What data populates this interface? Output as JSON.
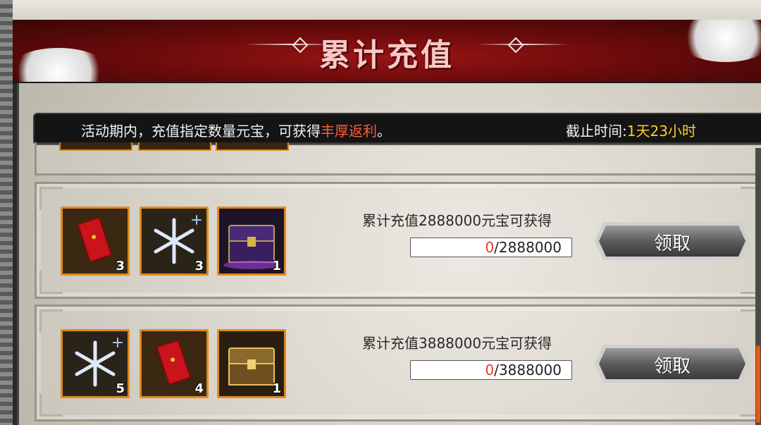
{
  "banner": {
    "title": "累计充值"
  },
  "info": {
    "text_prefix": "活动期内，充值指定数量元宝，可获得",
    "text_highlight": "丰厚返利",
    "text_suffix": "。",
    "deadline_label": "截止时间:",
    "deadline_value": "1天23小时"
  },
  "rewards": [
    {
      "description": "累计充值2888000元宝可获得",
      "current": "0",
      "target": "2888000",
      "claim_label": "领取",
      "items": [
        {
          "icon": "red-envelope-icon",
          "count": "3"
        },
        {
          "icon": "snowflake-icon",
          "count": "3"
        },
        {
          "icon": "purple-chest-icon",
          "count": "1"
        }
      ]
    },
    {
      "description": "累计充值3888000元宝可获得",
      "current": "0",
      "target": "3888000",
      "claim_label": "领取",
      "items": [
        {
          "icon": "snowflake-icon",
          "count": "5"
        },
        {
          "icon": "red-envelope-icon",
          "count": "4"
        },
        {
          "icon": "golden-chest-icon",
          "count": "1"
        }
      ]
    }
  ],
  "colors": {
    "highlight": "#ff5a3a",
    "deadline": "#ffcc33",
    "progress_current": "#e23b2b",
    "item_border": "#e08a1e"
  }
}
